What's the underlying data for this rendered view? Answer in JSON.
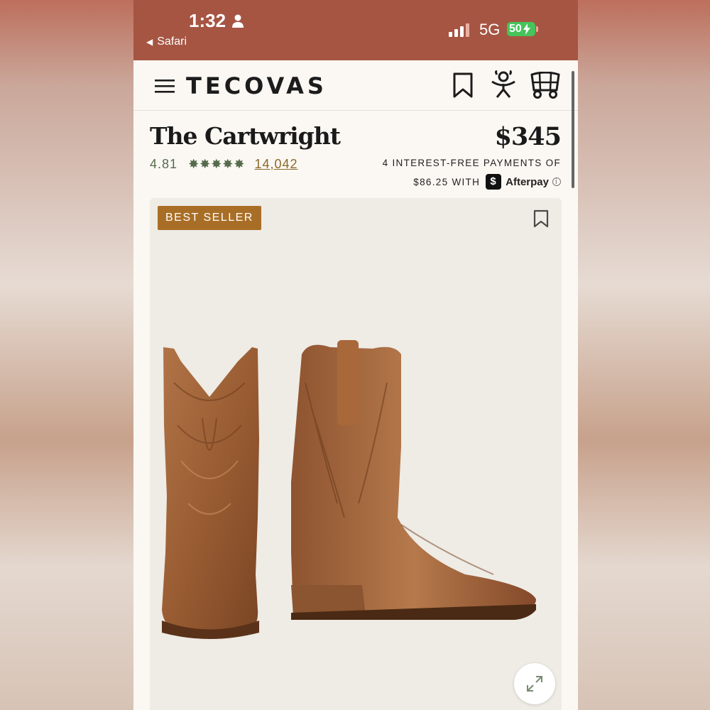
{
  "status_bar": {
    "time": "1:32",
    "back_app": "Safari",
    "network": "5G",
    "battery": "50"
  },
  "header": {
    "logo": "TECOVAS",
    "icons": [
      "menu-icon",
      "bookmark-icon",
      "account-icon",
      "wagon-cart-icon"
    ]
  },
  "product": {
    "title": "The Cartwright",
    "price": "$345",
    "rating": "4.81",
    "stars": "✸✸✸✸✸",
    "review_count": "14,042",
    "payments_line1": "4 INTEREST-FREE PAYMENTS OF",
    "payments_line2": "$86.25 WITH",
    "afterpay_logo_char": "$",
    "afterpay_label": "Afterpay",
    "info_symbol": "i"
  },
  "image_card": {
    "badge": "BEST SELLER",
    "icons": [
      "bookmark-icon",
      "expand-icon"
    ]
  },
  "colors": {
    "status_bar": "#a65543",
    "badge": "#a96e26",
    "rating_green": "#556b4c",
    "boot_leather": "#9a5d33"
  }
}
